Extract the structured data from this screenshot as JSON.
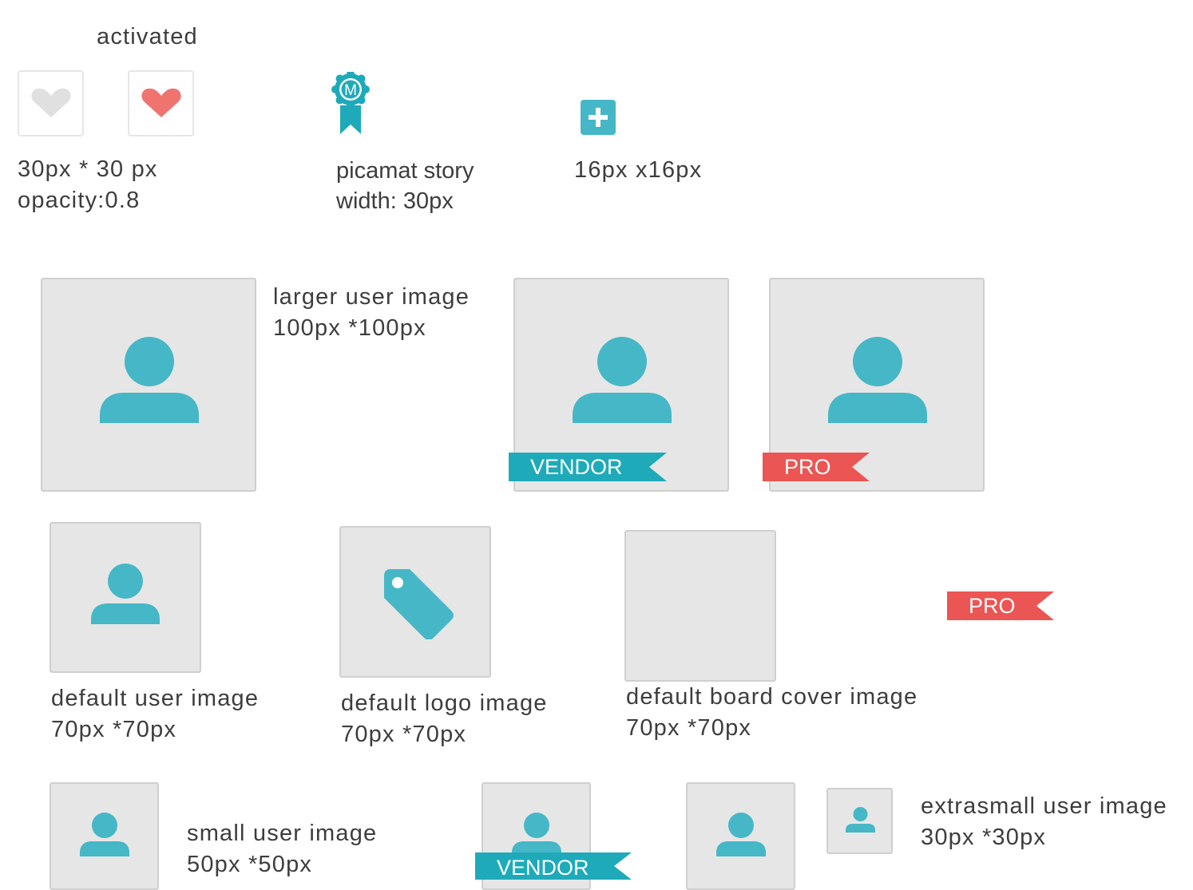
{
  "header": {
    "activated_label": "activated"
  },
  "likes": {
    "caption_line1": "30px * 30 px",
    "caption_line2": "opacity:0.8",
    "inactive_color": "#e0e0e0",
    "active_color": "#ef7470"
  },
  "story": {
    "badge_letter": "M",
    "caption_line1": "picamat story",
    "caption_line2": "width: 30px",
    "color": "#1eaab9"
  },
  "add": {
    "caption": "16px x16px",
    "color": "#45b7c6"
  },
  "large_user": {
    "line1": "larger user image",
    "line2": "100px *100px"
  },
  "badges": {
    "vendor": "VENDOR",
    "pro": "PRO",
    "vendor_color": "#1eaab9",
    "pro_color": "#eb5553"
  },
  "default_user": {
    "line1": "default user image",
    "line2": "70px *70px"
  },
  "default_logo": {
    "line1": "default logo image",
    "line2": "70px *70px"
  },
  "default_board": {
    "line1": "default board cover image",
    "line2": "70px *70px"
  },
  "small_user": {
    "line1": "small user image",
    "line2": "50px *50px"
  },
  "extrasmall_user": {
    "line1": "extrasmall user image",
    "line2": "30px *30px"
  },
  "colors": {
    "placeholder_bg": "#e6e6e6",
    "placeholder_border": "#cfcfcf",
    "icon_teal": "#46b7c6",
    "text": "#3d3d3d"
  }
}
